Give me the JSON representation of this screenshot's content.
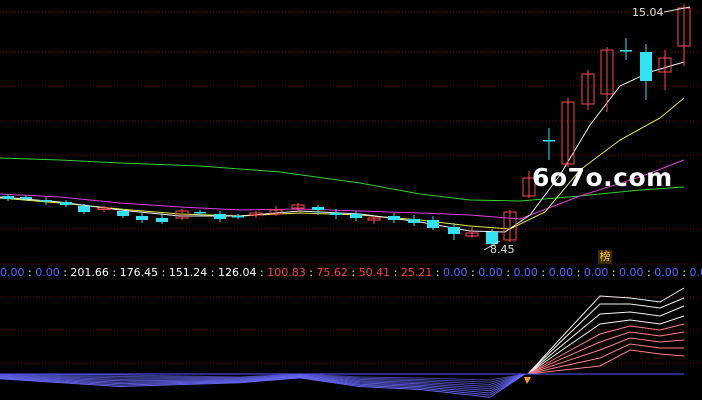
{
  "price_chart": {
    "high_label": "15.04",
    "low_label": "8.45"
  },
  "watermark": "6o7o.com",
  "badge": "榜",
  "value_strip": [
    {
      "text": "0.00",
      "tone": "zero"
    },
    {
      "text": "0.00",
      "tone": "zero"
    },
    {
      "text": "201.66",
      "tone": "plain"
    },
    {
      "text": "176.45",
      "tone": "plain"
    },
    {
      "text": "151.24",
      "tone": "plain"
    },
    {
      "text": "126.04",
      "tone": "plain"
    },
    {
      "text": "100.83",
      "tone": "red"
    },
    {
      "text": "75.62",
      "tone": "red"
    },
    {
      "text": "50.41",
      "tone": "red"
    },
    {
      "text": "25.21",
      "tone": "red"
    },
    {
      "text": "0.00",
      "tone": "zero"
    },
    {
      "text": "0.00",
      "tone": "zero"
    },
    {
      "text": "0.00",
      "tone": "zero"
    },
    {
      "text": "0.00",
      "tone": "zero"
    },
    {
      "text": "0.00",
      "tone": "zero"
    },
    {
      "text": "0.00",
      "tone": "zero"
    },
    {
      "text": "0.00",
      "tone": "zero"
    },
    {
      "text": "0.00",
      "tone": "zero"
    },
    {
      "text": "0.00",
      "tone": "zero"
    }
  ],
  "colors": {
    "up_candle": "#ff4a4a",
    "down_candle": "#35e0f0",
    "ma_white": "#f2f2f2",
    "ma_yellow": "#e8e84a",
    "ma_magenta": "#e040e0",
    "ma_green": "#30d030",
    "grid": "#7a0000",
    "lower_up": "#ff8080",
    "lower_down": "#6a6aff"
  }
}
